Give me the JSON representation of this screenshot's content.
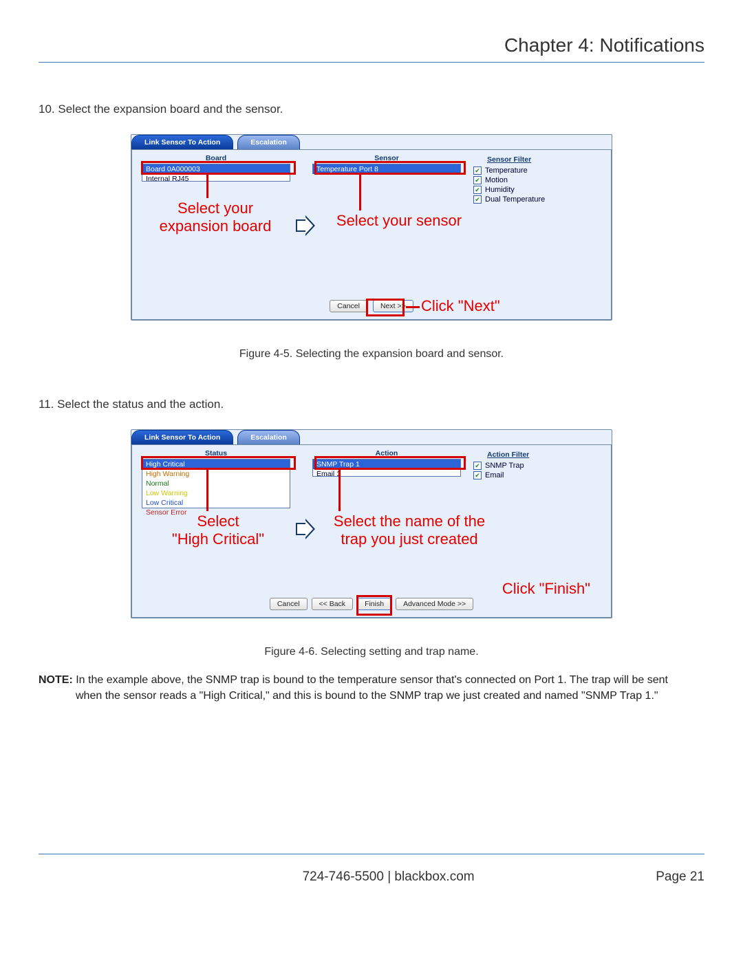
{
  "header": {
    "chapter_title": "Chapter 4: Notifications"
  },
  "step10": {
    "number": "10.",
    "text": "Select the expansion board and the sensor."
  },
  "fig5": {
    "tabs": {
      "main": "Link Sensor To Action",
      "secondary": "Escalation"
    },
    "board": {
      "title": "Board",
      "items": [
        "Board 0A000003",
        "Internal RJ45"
      ]
    },
    "sensor": {
      "title": "Sensor",
      "items": [
        "Temperature Port 8"
      ]
    },
    "filter": {
      "title": "Sensor Filter",
      "items": [
        "Temperature",
        "Motion",
        "Humidity",
        "Dual Temperature"
      ]
    },
    "callouts": {
      "board": "Select your\nexpansion board",
      "sensor": "Select your sensor",
      "next": "Click \"Next\""
    },
    "buttons": {
      "cancel": "Cancel",
      "next": "Next >>"
    },
    "caption": "Figure 4-5. Selecting the expansion board and sensor."
  },
  "step11": {
    "number": "11.",
    "text": "Select the status and the action."
  },
  "fig6": {
    "tabs": {
      "main": "Link Sensor To Action",
      "secondary": "Escalation"
    },
    "status": {
      "title": "Status",
      "items": [
        "High Critical",
        "High Warning",
        "Normal",
        "Low Warning",
        "Low Critical",
        "Sensor Error"
      ]
    },
    "action": {
      "title": "Action",
      "items": [
        "SNMP Trap 1",
        "Email 1"
      ]
    },
    "filter": {
      "title": "Action Filter",
      "items": [
        "SNMP Trap",
        "Email"
      ]
    },
    "callouts": {
      "status": "Select\n\"High Critical\"",
      "action": "Select the name of the\ntrap you just created",
      "finish": "Click \"Finish\""
    },
    "buttons": {
      "cancel": "Cancel",
      "back": "<< Back",
      "finish": "Finish",
      "advanced": "Advanced Mode >>"
    },
    "caption": "Figure 4-6. Selecting setting and trap name."
  },
  "note": {
    "label": "NOTE:",
    "line1": "In the example above, the SNMP trap is bound to the temperature sensor that's connected on Port 1. The trap will be sent",
    "line2": "when the sensor reads a \"High Critical,\" and this is bound to the SNMP trap we just created and named \"SNMP Trap 1.\""
  },
  "footer": {
    "center": "724-746-5500   |   blackbox.com",
    "page_label": "Page",
    "page_num": "21"
  }
}
